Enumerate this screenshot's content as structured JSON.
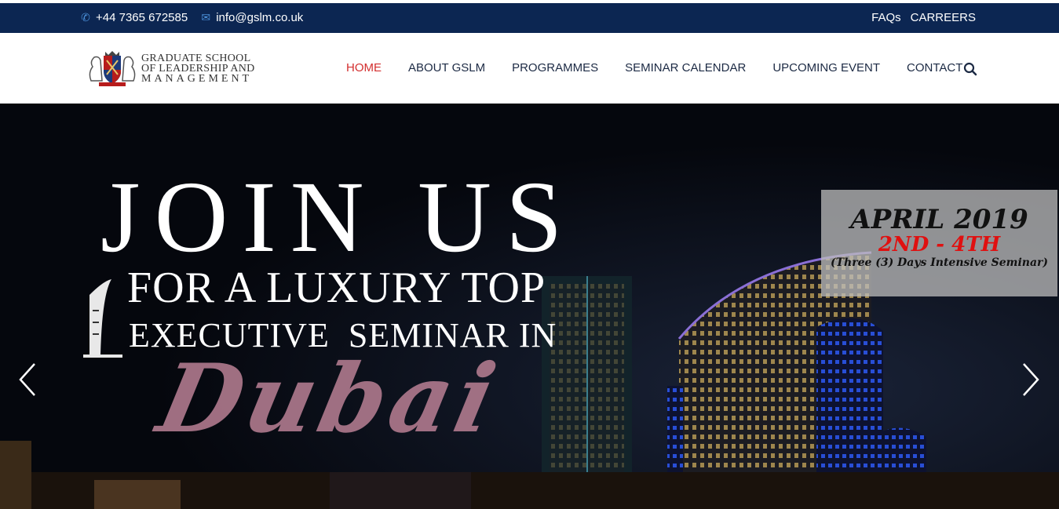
{
  "topbar": {
    "phone": "+44 7365 672585",
    "email": "info@gslm.co.uk",
    "links": [
      "FAQs",
      "CARREERS"
    ]
  },
  "logo": {
    "line1": "GRADUATE SCHOOL",
    "line2": "OF LEADERSHIP AND",
    "line3": "MANAGEMENT"
  },
  "nav": {
    "items": [
      "HOME",
      "ABOUT GSLM",
      "PROGRAMMES",
      "SEMINAR CALENDAR",
      "UPCOMING EVENT",
      "CONTACT"
    ],
    "active": "HOME"
  },
  "hero": {
    "headline": "JOIN US",
    "line2": "FOR A LUXURY TOP",
    "line3": "EXECUTIVE  SEMINAR IN",
    "city": "Dubai",
    "event": {
      "month": "APRIL 2019",
      "dates": "2ND - 4TH",
      "description": "(Three (3) Days Intensive Seminar)"
    }
  },
  "icons": {
    "phone": "phone-icon",
    "email": "envelope-icon",
    "search": "search-icon",
    "prev": "chevron-left-icon",
    "next": "chevron-right-icon"
  },
  "colors": {
    "topbar_bg": "#0c2652",
    "nav_active": "#d32f2f",
    "date_red": "#e01010"
  }
}
